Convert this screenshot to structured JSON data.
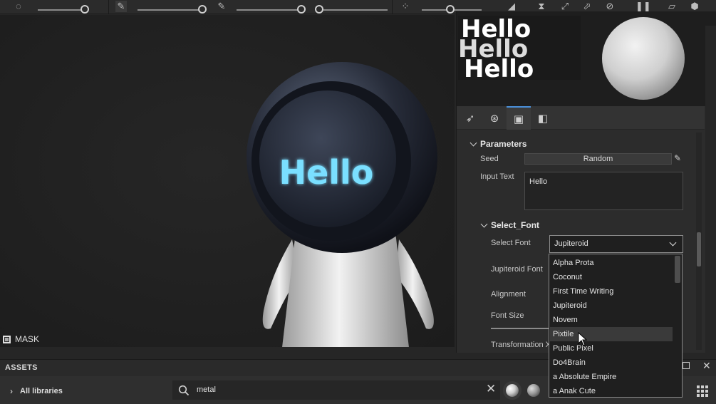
{
  "viewport": {
    "mask_label": "MASK",
    "mascot_text": "Hello"
  },
  "panel": {
    "preview_text": "Hello",
    "parameters_title": "Parameters",
    "seed_label": "Seed",
    "seed_button": "Random",
    "input_text_label": "Input Text",
    "input_text_value": "Hello",
    "select_font_title": "Select_Font",
    "select_font_label": "Select Font",
    "select_font_value": "Jupiteroid",
    "jupiteroid_font_label": "Jupiteroid Font",
    "alignment_label": "Alignment",
    "font_size_label": "Font Size",
    "transformation_label": "Transformation X"
  },
  "font_dropdown": {
    "options": [
      "Alpha Prota",
      "Coconut",
      "First Time Writing",
      "Jupiteroid",
      "Novem",
      "Pixtile",
      "Public Pixel",
      "Do4Brain",
      "a Absolute Empire",
      "a Anak Cute"
    ],
    "hovered": "Pixtile"
  },
  "assets": {
    "title": "ASSETS",
    "all_libraries": "All libraries",
    "search_value": "metal"
  },
  "colors": {
    "accent": "#4a90d9",
    "hello_glow": "#6fd3ff",
    "panel_bg": "#2c2c2c"
  }
}
